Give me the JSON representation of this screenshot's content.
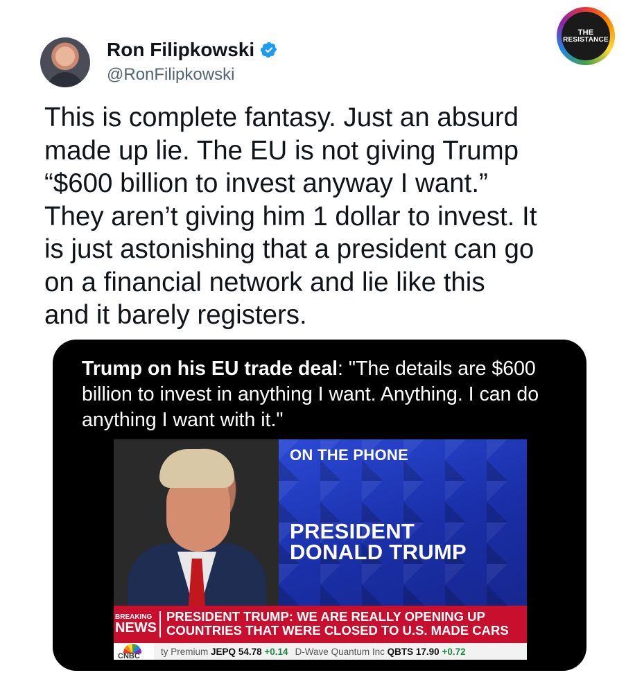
{
  "author": {
    "name": "Ron Filipkowski",
    "handle": "@RonFilipkowski",
    "verified": true,
    "avatar_icon": "profile-photo"
  },
  "badge": {
    "line1": "THE",
    "line2": "RESISTANCE"
  },
  "tweet": {
    "text": "This is complete fantasy. Just an absurd\nmade up lie. The EU is not giving Trump\n“$600 billion to invest anyway I want.”\nThey aren’t giving him 1 dollar to invest. It\nis just astonishing that a president can go\non a financial network and lie like this\nand it barely registers."
  },
  "media": {
    "caption_bold": "Trump on his EU trade deal",
    "caption_rest": ": \"The details are $600 billion to invest in anything I want. Anything. I can do anything I want with it.\"",
    "video": {
      "on_phone": "ON THE PHONE",
      "president_line1": "PRESIDENT",
      "president_line2": "DONALD TRUMP",
      "breaking_1": "BREAKING",
      "breaking_2": "NEWS",
      "headline": "PRESIDENT TRUMP: WE ARE REALLY OPENING UP COUNTRIES THAT WERE CLOSED TO U.S. MADE CARS",
      "network": "CNBC",
      "ticker": [
        {
          "name": "ty Premium",
          "symbol": "JEPQ",
          "price": "54.78",
          "change": "+0.14"
        },
        {
          "name": "D-Wave Quantum Inc",
          "symbol": "QBTS",
          "price": "17.90",
          "change": "+0.72"
        }
      ]
    }
  },
  "colors": {
    "verified_blue": "#1d9bf0",
    "cnbc_red": "#c8102e",
    "panel_blue": "#2b4ad6"
  }
}
